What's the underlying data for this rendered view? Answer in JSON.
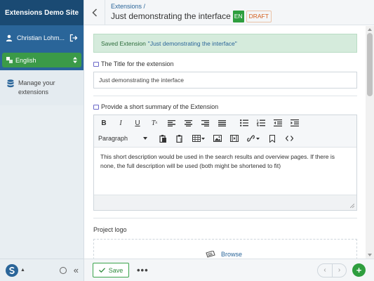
{
  "sidebar": {
    "site_title": "Extensions Demo Site",
    "user_name": "Christian Lohm...",
    "language": "English",
    "menu_extensions": "Manage your extensions"
  },
  "header": {
    "breadcrumb": "Extensions /",
    "title": "Just demonstrating the interface",
    "lang_badge": "EN",
    "status": "DRAFT"
  },
  "alert": {
    "text": "Saved Extension",
    "quote": "\"Just demonstrating the interface\""
  },
  "fields": {
    "title_label": "The Title for the extension",
    "title_value": "Just demonstrating the interface",
    "summary_label": "Provide a short summary of the Extension",
    "format": "Paragraph",
    "summary_text": "This short description would be used in the search results and overview pages. If there is none, the full description will be used (both might be shortened to fit)",
    "logo_label": "Project logo",
    "browse": "Browse"
  },
  "footer": {
    "save": "Save",
    "more": "•••",
    "add": "+"
  },
  "colors": {
    "sidebar_dark": "#1a4a73",
    "sidebar_blue": "#2a6599",
    "green": "#2e9e3e",
    "draft_orange": "#d45d1a",
    "alert_bg": "#d5ebdc"
  },
  "icons": [
    "user-icon",
    "logout-icon",
    "language-icon",
    "database-icon",
    "brand-logo-icon",
    "back-icon",
    "bold-icon",
    "italic-icon",
    "underline-icon",
    "clear-format-icon",
    "align-left-icon",
    "align-center-icon",
    "align-right-icon",
    "align-justify-icon",
    "bullet-list-icon",
    "numbered-list-icon",
    "outdent-icon",
    "indent-icon",
    "paste-icon",
    "paste-text-icon",
    "table-icon",
    "image-icon",
    "media-icon",
    "link-icon",
    "bookmark-icon",
    "code-icon",
    "image-upload-icon",
    "check-icon",
    "chevron-left-icon",
    "chevron-right-icon",
    "plus-icon"
  ]
}
